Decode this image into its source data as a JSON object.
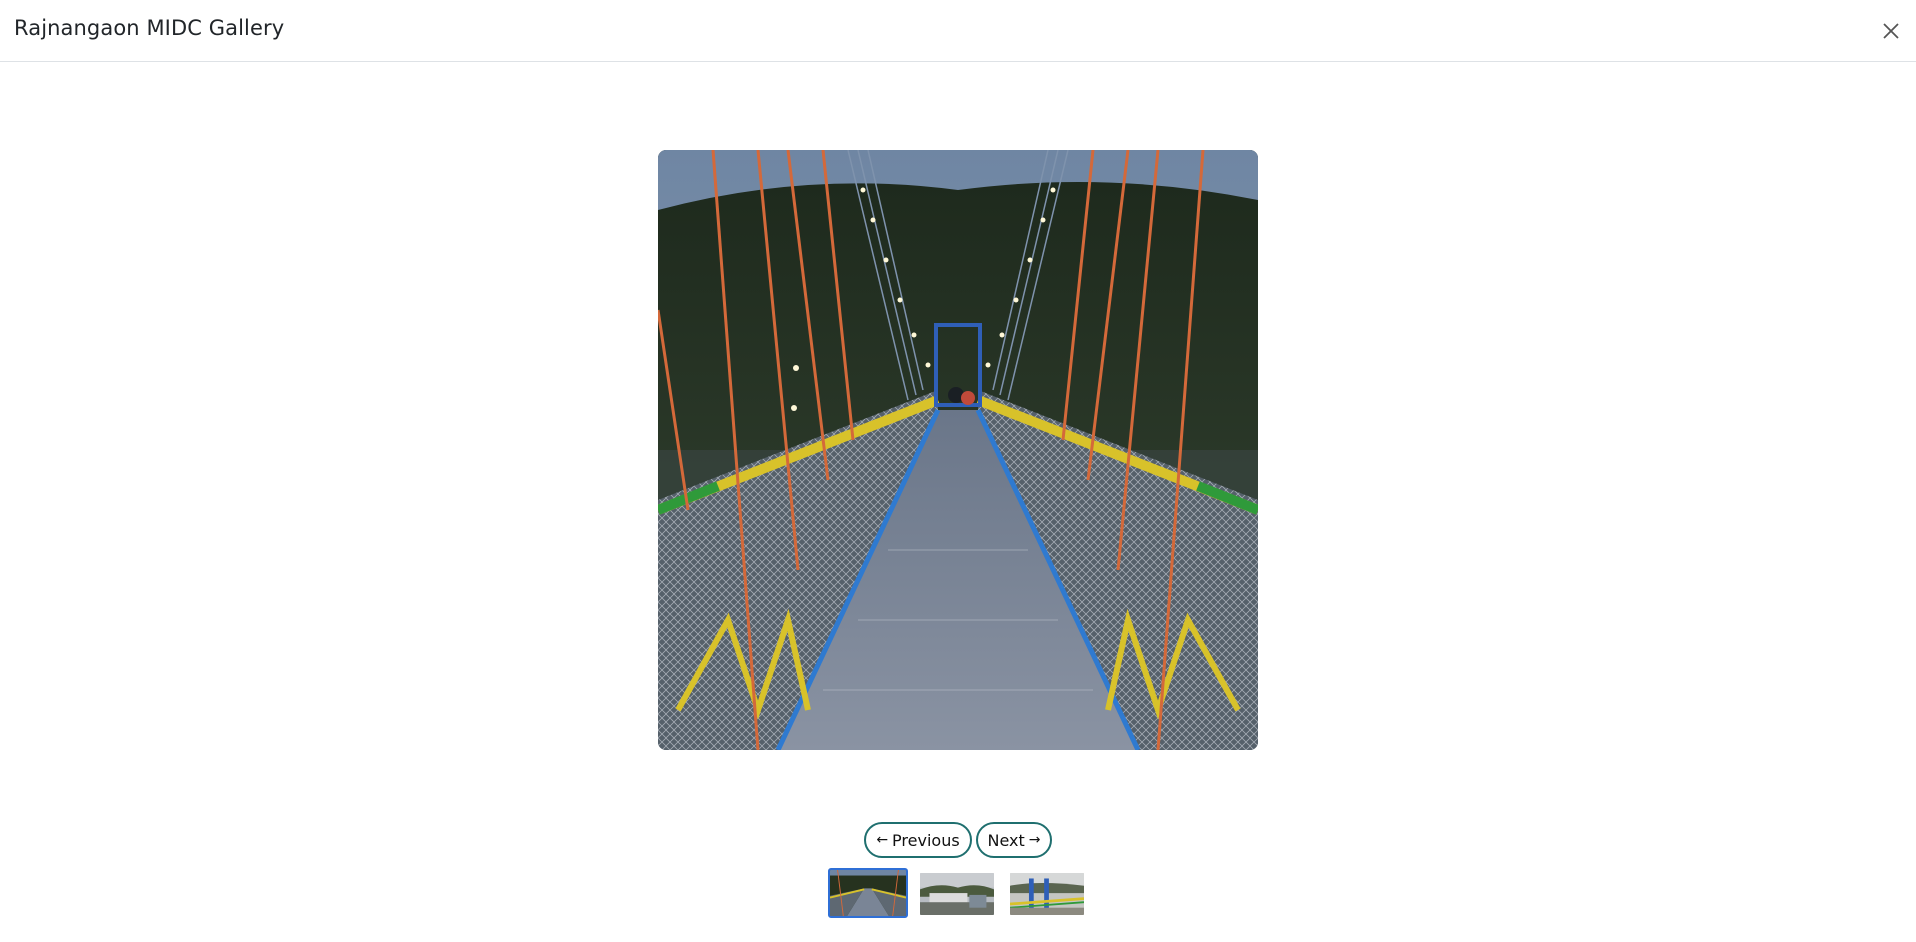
{
  "modal": {
    "title": "Rajnangaon MIDC Gallery",
    "close_icon": "close-icon"
  },
  "main_image": {
    "subject": "suspension footbridge at dusk"
  },
  "navigation": {
    "previous_label": "Previous",
    "next_label": "Next",
    "previous_icon": "arrow-left-icon",
    "next_icon": "arrow-right-icon"
  },
  "thumbnails": {
    "count": 3,
    "active_index": 0,
    "active_border_color": "#2f6fd6"
  },
  "colors": {
    "button_border": "#1f6f6f",
    "header_border": "#dee2e6"
  }
}
